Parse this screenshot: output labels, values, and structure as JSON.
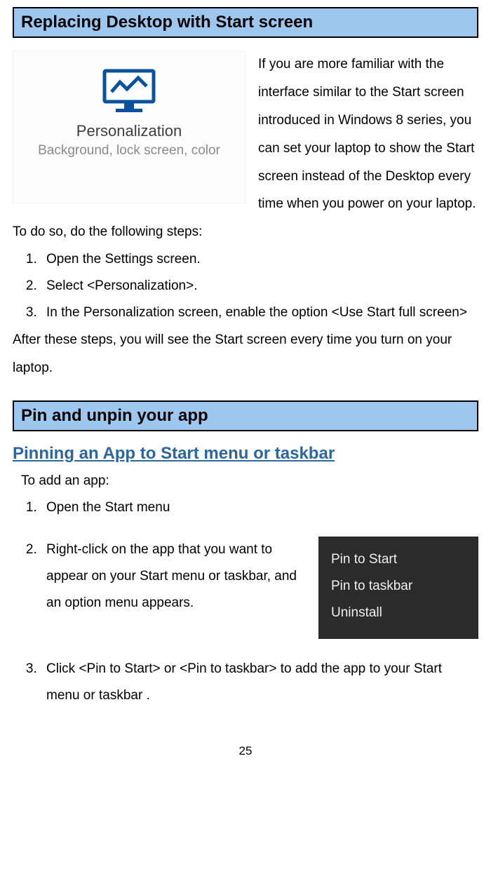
{
  "section1": {
    "title": "Replacing Desktop with Start screen",
    "illustration": {
      "title": "Personalization",
      "subtitle": "Background, lock screen, color"
    },
    "intro": "If you are more familiar with the interface similar to the Start screen introduced in Windows 8 series, you can set your laptop to show the Start screen instead of the Desktop every time when you power on your laptop. To do so, do the following steps:",
    "steps": [
      "Open the Settings screen.",
      "Select <Personalization>.",
      "In the Personalization screen, enable the option <Use Start full screen>"
    ],
    "outro": "After these steps, you will see the Start screen every time you turn on your laptop."
  },
  "section2": {
    "title": "Pin and unpin your app",
    "subheading": "Pinning an App to Start menu or taskbar",
    "intro": "To add an app:",
    "steps": [
      "Open the Start menu",
      "Right-click on the app that you want to appear on your Start menu or taskbar, and an option menu appears.",
      "Click <Pin to Start> or <Pin to taskbar> to add the app to your Start menu or taskbar ."
    ],
    "menu": {
      "item1": "Pin to Start",
      "item2": "Pin to taskbar",
      "item3": "Uninstall"
    }
  },
  "page_number": "25"
}
